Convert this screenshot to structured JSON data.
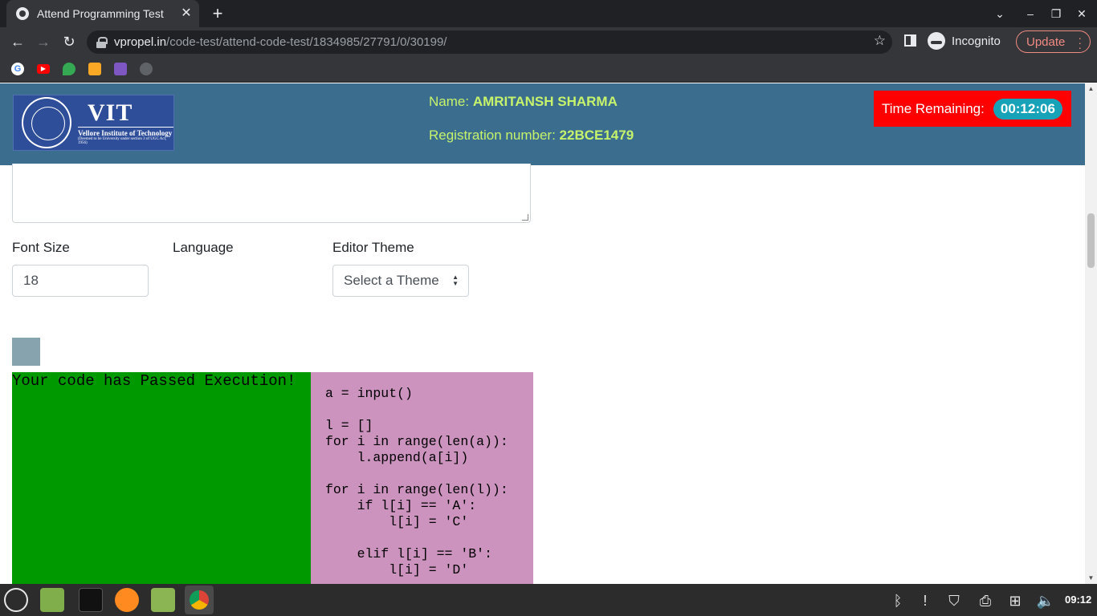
{
  "browser": {
    "tab_title": "Attend Programming Test",
    "url_host": "vpropel.in",
    "url_path": "/code-test/attend-code-test/1834985/27791/0/30199/",
    "profile_label": "Incognito",
    "update_label": "Update"
  },
  "header": {
    "logo_title": "VIT",
    "logo_subtitle": "Vellore Institute of Technology",
    "logo_tagline": "(Deemed to be University under section 3 of UGC Act, 1956)",
    "name_label": "Name:",
    "name_value": "AMRITANSH SHARMA",
    "reg_label": "Registration number:",
    "reg_value": "22BCE1479",
    "timer_label": "Time Remaining:",
    "timer_value": "00:12:06"
  },
  "controls": {
    "font_size_label": "Font Size",
    "font_size_value": "18",
    "language_label": "Language",
    "theme_label": "Editor Theme",
    "theme_value": "Select a Theme"
  },
  "result": {
    "message": "Your code has Passed Execution!"
  },
  "code": {
    "text": "a = input()\n\nl = []\nfor i in range(len(a)):\n    l.append(a[i])\n\nfor i in range(len(l)):\n    if l[i] == 'A':\n        l[i] = 'C'\n\n    elif l[i] == 'B':\n        l[i] = 'D'"
  },
  "taskbar": {
    "clock": "09:12"
  },
  "colors": {
    "header_bg": "#3b6d8f",
    "timer_bg": "#ff0000",
    "timer_badge": "#17a2b8",
    "result_bg": "#009900",
    "code_bg": "#cc93bf",
    "student_text": "#c6f36b"
  }
}
